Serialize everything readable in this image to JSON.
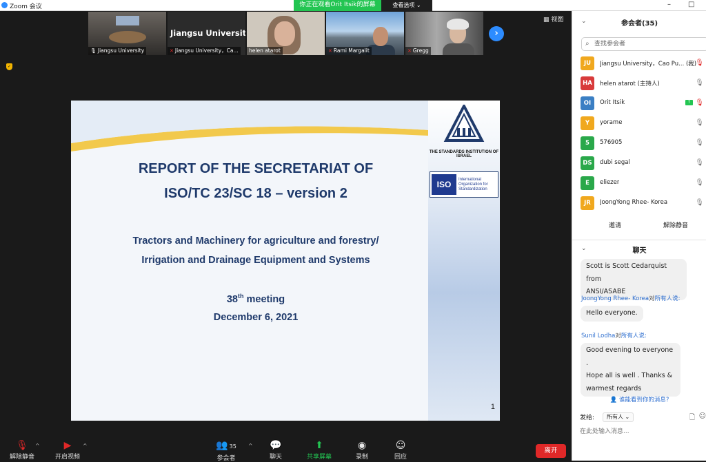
{
  "window": {
    "title": "Zoom 会议",
    "controls": [
      "–",
      "□",
      "✕"
    ]
  },
  "share_banner": {
    "text": "你正在观看Orit Itsik的屏幕",
    "options_label": "查看选项 ⌄"
  },
  "view_button": {
    "label": "▦ 视图"
  },
  "thumbnails": [
    {
      "name": "Jiangsu University",
      "big_name": "",
      "muted": false,
      "active": true
    },
    {
      "name": "Jiangsu University，Ca...",
      "big_name": "Jiangsu Universit...",
      "muted": true,
      "active": false
    },
    {
      "name": "helen atarot",
      "big_name": "",
      "muted": false,
      "active": false
    },
    {
      "name": "Rami Margalit",
      "big_name": "",
      "muted": true,
      "active": false
    },
    {
      "name": "Gregg",
      "big_name": "",
      "muted": true,
      "active": false
    }
  ],
  "slide": {
    "title_line1": "REPORT OF THE SECRETARIAT OF",
    "title_line2": "ISO/TC 23/SC 18 – version 2",
    "subtitle_line1": "Tractors and Machinery for agriculture and forestry/",
    "subtitle_line2": "Irrigation and Drainage Equipment and Systems",
    "meeting_number": "38",
    "meeting_suffix": "th",
    "meeting_word": " meeting",
    "date": "December 6, 2021",
    "page_number": "1",
    "sii_caption": "THE STANDARDS INSTITUTION OF ISRAEL",
    "iso_mark": "ISO",
    "iso_text_1": "International",
    "iso_text_2": "Organization for",
    "iso_text_3": "Standardization"
  },
  "toolbar": {
    "unmute_label": "解除静音",
    "start_video_label": "开启视频",
    "participants_label": "参会者",
    "participants_count": "35",
    "chat_label": "聊天",
    "share_label": "共享屏幕",
    "record_label": "录制",
    "reactions_label": "回应",
    "leave_label": "离开"
  },
  "participants_panel": {
    "title": "参会者(35)",
    "search_placeholder": "查找参会者",
    "participants": [
      {
        "initials": "JU",
        "name": "Jiangsu University，Cao Pu...  (我)",
        "color": "#f0a81e",
        "mic": "muted",
        "sharing": false
      },
      {
        "initials": "HA",
        "name": "helen atarot (主持人)",
        "color": "#d83b3b",
        "mic": "on",
        "sharing": false
      },
      {
        "initials": "OI",
        "name": "Orit Itsik",
        "color": "#3b7fc4",
        "mic": "muted",
        "sharing": true
      },
      {
        "initials": "Y",
        "name": "yorame",
        "color": "#f0a81e",
        "mic": "on",
        "sharing": false
      },
      {
        "initials": "5",
        "name": "576905",
        "color": "#2aa84a",
        "mic": "on",
        "sharing": false
      },
      {
        "initials": "DS",
        "name": "dubi segal",
        "color": "#2aa84a",
        "mic": "on",
        "sharing": false
      },
      {
        "initials": "E",
        "name": "eliezer",
        "color": "#2aa84a",
        "mic": "on",
        "sharing": false
      },
      {
        "initials": "JR",
        "name": "JoongYong Rhee- Korea",
        "color": "#f0a81e",
        "mic": "on",
        "sharing": false
      }
    ],
    "invite_label": "邀请",
    "unmute_label": "解除静音"
  },
  "chat_panel": {
    "title": "聊天",
    "messages": [
      {
        "sender": "",
        "to": "",
        "lines": [
          "Scott is Scott Cedarquist from",
          "ANSI/ASABE"
        ]
      },
      {
        "sender": "JoongYong Rhee- Korea",
        "to": "对",
        "target": "所有人说:",
        "lines": [
          "Hello everyone."
        ]
      },
      {
        "sender": "Sunil Lodha",
        "to": "对",
        "target": "所有人说:",
        "lines": [
          "Good evening to everyone .",
          "Hope all is well . Thanks &",
          "warmest regards"
        ]
      }
    ],
    "who_can_see": "谁能看到你的消息?",
    "send_to_label": "发给:",
    "send_to_value": "所有人 ⌄",
    "input_placeholder": "在此处输入消息..."
  }
}
